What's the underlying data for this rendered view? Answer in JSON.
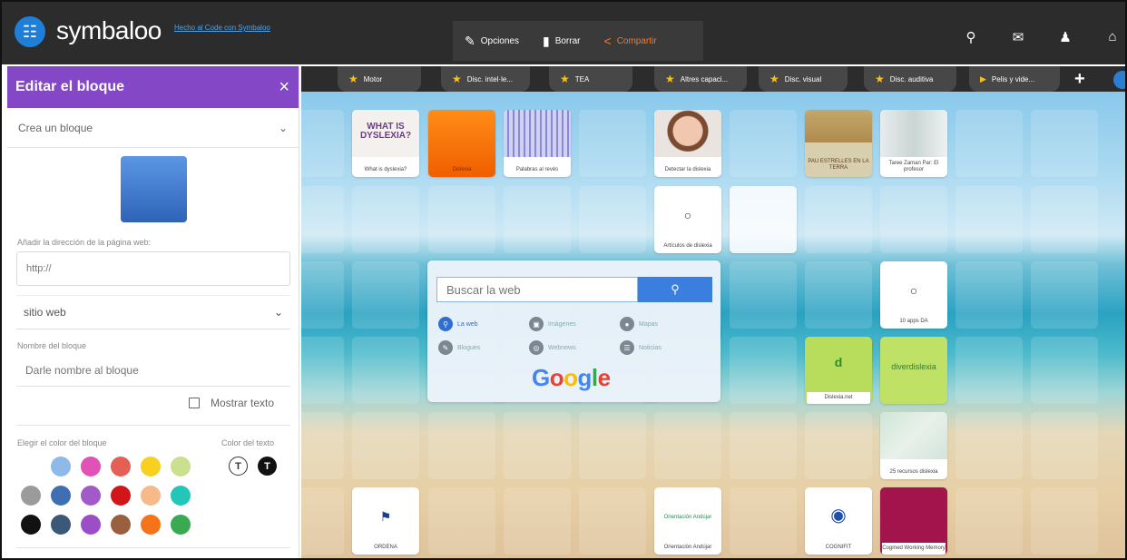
{
  "app": {
    "name": "symbaloo",
    "made_link": "Hecho al Code con Symbaloo"
  },
  "toolbar": {
    "options": "Opciones",
    "delete": "Borrar",
    "share": "Compartir"
  },
  "top_icons": [
    "search-icon",
    "mail-icon",
    "user-icon",
    "home-icon"
  ],
  "panel": {
    "title": "Editar el bloque",
    "create_label": "Crea un bloque",
    "url_label": "Añadir la dirección de la página web:",
    "url_value": "http://",
    "type_select": "sitio web",
    "name_label": "Nombre del bloque",
    "name_placeholder": "Darle nombre al bloque",
    "show_text": "Mostrar texto",
    "bg_color_label": "Elegir el color del bloque",
    "text_color_label": "Color del texto",
    "text_white": "T",
    "text_black": "T"
  },
  "colors": {
    "accent_purple": "#8448c6",
    "swatches": [
      "#ffffff",
      "#8fb9e8",
      "#e052b6",
      "#e56054",
      "#f8d01f",
      "#cbe08e",
      "#9b9b9b",
      "#3e6fb3",
      "#a35ac9",
      "#d21618",
      "#f6b98a",
      "#23c7b9",
      "#111111",
      "#3b5878",
      "#9c4ec7",
      "#9a5f3e",
      "#f5741a",
      "#3aaa52"
    ]
  },
  "tabs": [
    {
      "label": "Motor",
      "icon": "star"
    },
    {
      "label": "Disc. intel·le...",
      "icon": "star"
    },
    {
      "label": "TEA",
      "icon": "star"
    },
    {
      "label": "Altres capaci...",
      "icon": "star"
    },
    {
      "label": "Disc. visual",
      "icon": "star"
    },
    {
      "label": "Disc. auditiva",
      "icon": "star"
    },
    {
      "label": "Pelis y vide...",
      "icon": "play"
    }
  ],
  "tiles": {
    "dyslexia": {
      "img_text": "WHAT IS DYSLEXIA?",
      "label": "What is dyslexia?"
    },
    "orange": {
      "label": "Dislexia"
    },
    "palabras": {
      "label": "Palabras al revés"
    },
    "woman": {
      "label": "Detectar la dislexia"
    },
    "estrellas": {
      "img_text": "PAU ESTRELLES EN LA TERRA",
      "label": ""
    },
    "taree": {
      "label": "Taree Zaman Par: El profesor"
    },
    "articulos": {
      "label": "Artículos de dislexia"
    },
    "apps": {
      "label": "10 apps DA"
    },
    "dislexia_net": {
      "letter": "d",
      "label": "Dislexia.net"
    },
    "diverdislexia": {
      "img_text": "diverdislexia",
      "label": ""
    },
    "recursos": {
      "label": "25 recursos dislexia"
    },
    "ordena": {
      "label": "ORDENA"
    },
    "orientacion": {
      "img_text": "Orientación Andújar",
      "label": "Orientación Andújar"
    },
    "cognifit": {
      "label": "COGNIFIT"
    },
    "cogmed": {
      "label": "Cogmed Working Memory"
    }
  },
  "google": {
    "search_placeholder": "Buscar la web",
    "options": [
      "La web",
      "Imágenes",
      "Mapas",
      "Blogues",
      "Webnews",
      "Noticias"
    ],
    "logo": "Google"
  }
}
